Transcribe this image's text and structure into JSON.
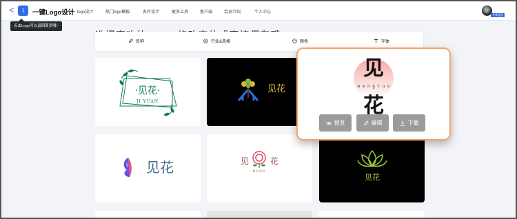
{
  "nav": {
    "back": "<",
    "brand_badge": "i",
    "brand": "一键Logo设计",
    "items": [
      "logo设计",
      "热门logo模板",
      "名片设计",
      "更多工具",
      "客户端",
      "会员介绍",
      "个人中心"
    ],
    "vip_badge": "专享会员"
  },
  "tooltip": "点击Logo可以返回首页哦~",
  "headline": "选择喜欢的LOGO修改字体或直接保存哦",
  "filters": [
    "名称",
    "行业&风格",
    "颜色",
    "字体"
  ],
  "cards": [
    {
      "cn": "·见花·",
      "en": "JI YUAN"
    },
    {
      "cn": "见花"
    },
    {
      "cn_top": "见",
      "en": "m e n g t u o",
      "cn_bottom": "花"
    },
    {
      "cn": "见花"
    },
    {
      "cn_left": "见",
      "cn_right": "花",
      "en": "ROSE"
    },
    {
      "cn": "见花"
    }
  ],
  "actions": {
    "preview": "预览",
    "edit": "编辑",
    "download": "下载"
  },
  "colors": {
    "accent": "#2f6fe8",
    "overlay_border": "#f4a56c",
    "button_grey": "#9b9b9b",
    "gold": "#e2c33c",
    "green": "#157a63",
    "rose": "#d94c62"
  }
}
